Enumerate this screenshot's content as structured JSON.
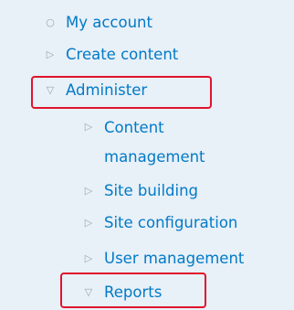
{
  "menu": {
    "items": [
      {
        "label": "My account",
        "icon": "bullet-circle-icon"
      },
      {
        "label": "Create content",
        "icon": "triangle-right-icon"
      },
      {
        "label": "Administer",
        "icon": "triangle-down-icon"
      },
      {
        "label": "Content management",
        "icon": "triangle-right-icon"
      },
      {
        "label": "Site building",
        "icon": "triangle-right-icon"
      },
      {
        "label": "Site configuration",
        "icon": "triangle-right-icon"
      },
      {
        "label": "User management",
        "icon": "triangle-right-icon"
      },
      {
        "label": "Reports",
        "icon": "triangle-down-icon"
      }
    ],
    "link_color": "#027ac6",
    "icon_color": "#9aa6b2",
    "background": "#e8f0f8",
    "highlight_color": "#e0142c"
  }
}
